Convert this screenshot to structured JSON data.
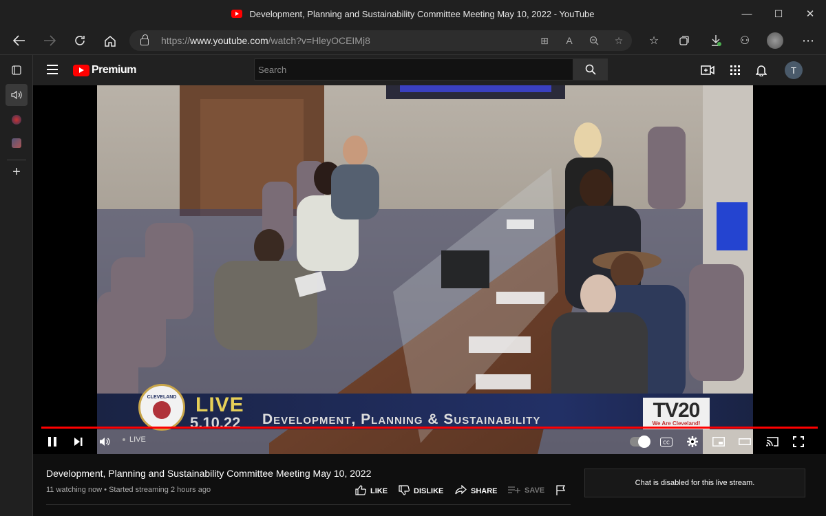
{
  "window": {
    "title": "Development, Planning and Sustainability Committee Meeting May 10, 2022 - YouTube",
    "controls": {
      "minimize": "—",
      "maximize": "☐",
      "close": "✕"
    }
  },
  "browser": {
    "url_prefix": "https://",
    "url_host": "www.youtube.com",
    "url_path": "/watch?v=HleyOCEIMj8"
  },
  "youtube": {
    "logo_text": "Premium",
    "search_placeholder": "Search",
    "avatar_letter": "T"
  },
  "player": {
    "overlay": {
      "seal_text": "CLEVELAND",
      "live": "LIVE",
      "date": "5.10.22",
      "program_title": "Development, Planning & Sustainability",
      "channel_logo": "TV20",
      "channel_tagline": "We Are Cleveland!"
    },
    "live_label": "LIVE",
    "progress_fraction": 1.0
  },
  "video": {
    "title": "Development, Planning and Sustainability Committee Meeting May 10, 2022",
    "meta": "11 watching now • Started streaming 2 hours ago",
    "actions": {
      "like": "LIKE",
      "dislike": "DISLIKE",
      "share": "SHARE",
      "save": "SAVE"
    }
  },
  "chat": {
    "message": "Chat is disabled for this live stream."
  },
  "colors": {
    "youtube_red": "#ff0000",
    "background": "#0f0f0f",
    "overlay_gold": "#e6cf58"
  }
}
